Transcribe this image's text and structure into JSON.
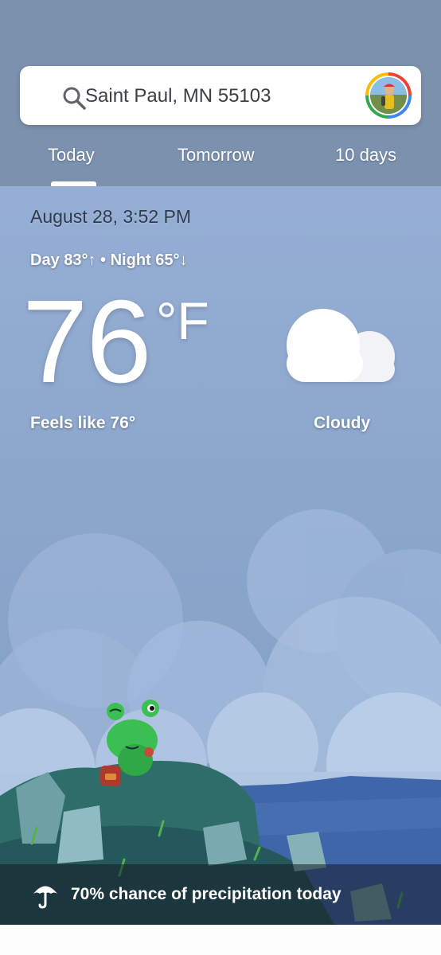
{
  "search": {
    "location": "Saint Paul, MN 55103"
  },
  "tabs": [
    {
      "label": "Today",
      "selected": true
    },
    {
      "label": "Tomorrow",
      "selected": false
    },
    {
      "label": "10 days",
      "selected": false
    }
  ],
  "current": {
    "date_time": "August 28, 3:52 PM",
    "day_night": "Day 83°↑ • Night 65°↓",
    "temperature": "76",
    "unit": "°F",
    "feels_like": "Feels like 76°",
    "condition": "Cloudy",
    "condition_icon": "cloud-icon"
  },
  "precipitation": {
    "text": "70% chance of precipitation today",
    "icon": "umbrella-icon"
  },
  "colors": {
    "header": "#7b91ae",
    "sky": "#93acd2",
    "text_white": "#ffffff",
    "date_text": "#2f3b4d"
  }
}
